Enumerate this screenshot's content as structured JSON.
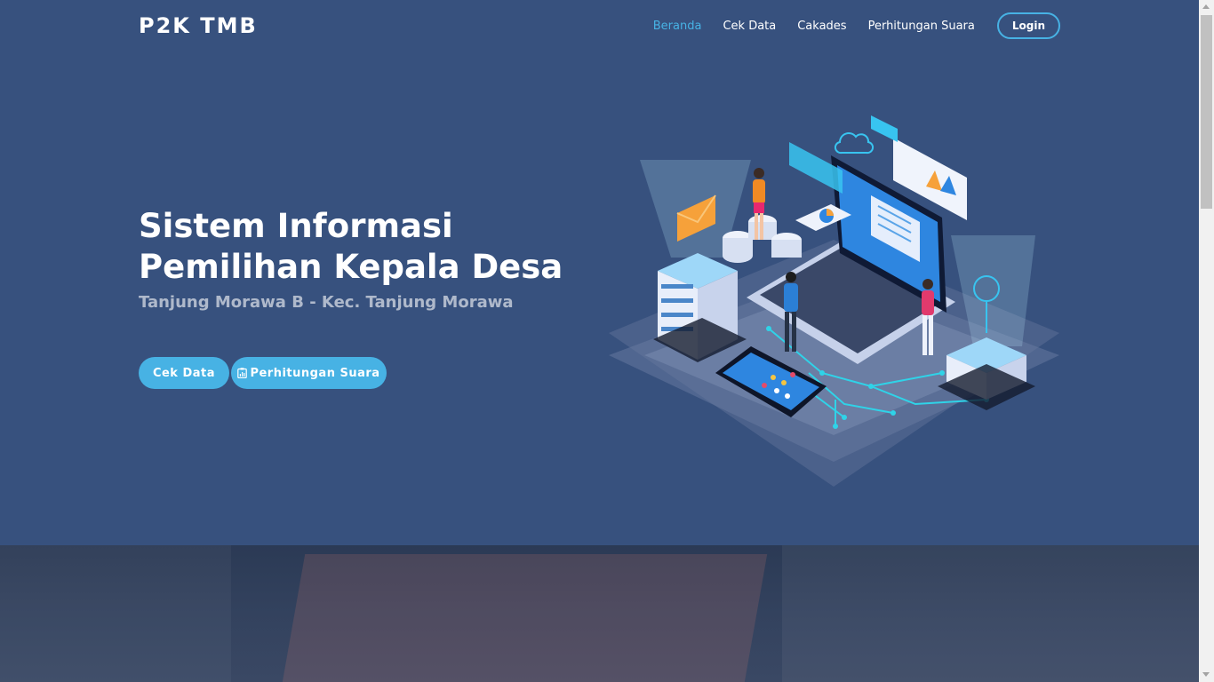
{
  "header": {
    "logo": "P2K TMB",
    "nav": [
      {
        "label": "Beranda",
        "active": true
      },
      {
        "label": "Cek Data",
        "active": false
      },
      {
        "label": "Cakades",
        "active": false
      },
      {
        "label": "Perhitungan Suara",
        "active": false
      }
    ],
    "login_label": "Login"
  },
  "hero": {
    "title": "Sistem Informasi Pemilihan Kepala Desa",
    "subtitle": "Tanjung Morawa B - Kec. Tanjung Morawa",
    "btn_cek_data": "Cek Data",
    "btn_perhitungan": "Perhitungan Suara",
    "btn_perhitungan_icon": "clipboard-chart-icon",
    "illustration_icon": "computer-network-illustration-icon"
  },
  "colors": {
    "background": "#37517e",
    "accent": "#47b2e4",
    "text": "#ffffff"
  }
}
